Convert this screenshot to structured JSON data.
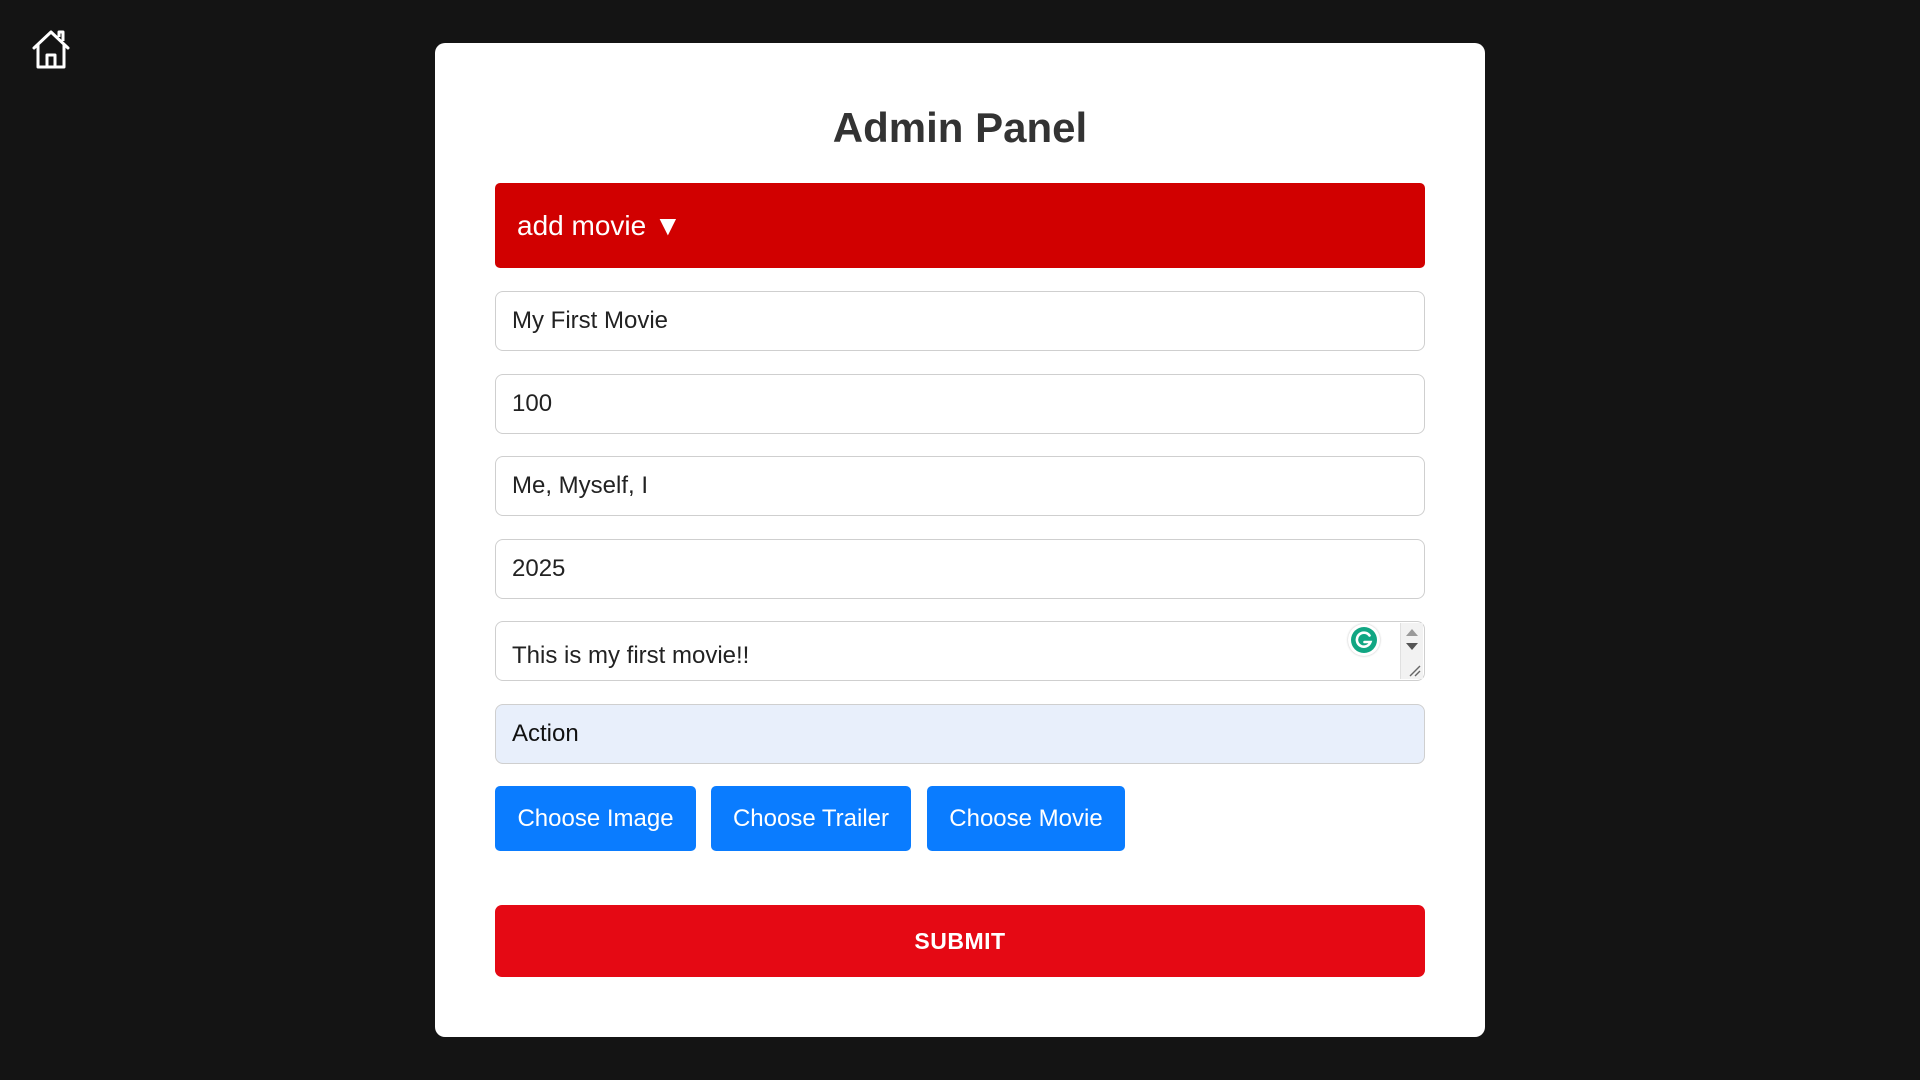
{
  "nav": {
    "home_icon": "home-icon"
  },
  "panel": {
    "title": "Admin Panel",
    "section_toggle": "add movie ▼"
  },
  "form": {
    "title_value": "My First Movie",
    "duration_value": "100",
    "director_value": "Me, Myself, I",
    "year_value": "2025",
    "description_value": "This is my first movie!!",
    "genre_value": "Action"
  },
  "buttons": {
    "choose_image": "Choose Image",
    "choose_trailer": "Choose Trailer",
    "choose_movie": "Choose Movie",
    "submit": "SUBMIT"
  },
  "colors": {
    "page_bg": "#141414",
    "panel_bg": "#ffffff",
    "toggle_red": "#d10000",
    "submit_red": "#e50914",
    "file_blue": "#0a7cff",
    "select_bg": "#e8effb",
    "grammarly_green": "#15c39a"
  }
}
